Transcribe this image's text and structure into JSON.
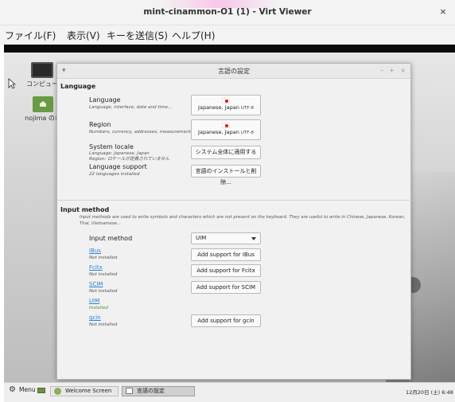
{
  "window": {
    "title": "mint-cinammon-O1 (1) - Virt Viewer",
    "close_glyph": "×"
  },
  "menubar": {
    "items": [
      "ファイル(F)",
      "表示(V)",
      "キーを送信(S)",
      "ヘルプ(H)"
    ]
  },
  "desktop": {
    "icons": [
      {
        "label": "コンピュー",
        "icon": "computer-icon"
      },
      {
        "label": "nojima のホ",
        "icon": "home-folder-icon"
      }
    ]
  },
  "dialog": {
    "title": "言語の設定",
    "controls": {
      "minimize": "–",
      "maximize": "+",
      "close": "×"
    },
    "language_section": {
      "title": "Language",
      "rows": [
        {
          "label": "Language",
          "sub": "Language, interface, date and time...",
          "button": "Japanese, Japan",
          "encoding": "UTF-8"
        },
        {
          "label": "Region",
          "sub": "Numbers, currency, addresses, measurement...",
          "button": "Japanese, Japan",
          "encoding": "UTF-8"
        },
        {
          "label": "System locale",
          "sub_line1": "Language: Japanese, Japan",
          "sub_line2": "Region: ロケールが定義されていません",
          "button": "システム全体に適用する"
        },
        {
          "label": "Language support",
          "sub": "22 languages installed",
          "button": "言語のインストールと削除..."
        }
      ]
    },
    "input_section": {
      "title": "Input method",
      "description_line1": "Input methods are used to write symbols and characters which are not present on the keyboard. They are useful to write in Chinese, Japanese, Korean,",
      "description_line2": "Thai, Vietnamese...",
      "selector_label": "Input method",
      "selector_value": "UIM",
      "methods": [
        {
          "name": "IBus",
          "status": "Not installed",
          "button": "Add support for IBus"
        },
        {
          "name": "Fcitx",
          "status": "Not installed",
          "button": "Add support for Fcitx"
        },
        {
          "name": "SCIM",
          "status": "Not installed",
          "button": "Add support for SCIM"
        },
        {
          "name": "UIM",
          "status": "Installed",
          "button": ""
        },
        {
          "name": "gcin",
          "status": "Not installed",
          "button": "Add support for gcin"
        }
      ]
    }
  },
  "taskbar": {
    "menu_label": "Menu",
    "windows": [
      {
        "label": "Welcome Screen",
        "active": false
      },
      {
        "label": "言語の設定",
        "active": true
      }
    ],
    "clock": "12月20日 (土) 6:48"
  }
}
